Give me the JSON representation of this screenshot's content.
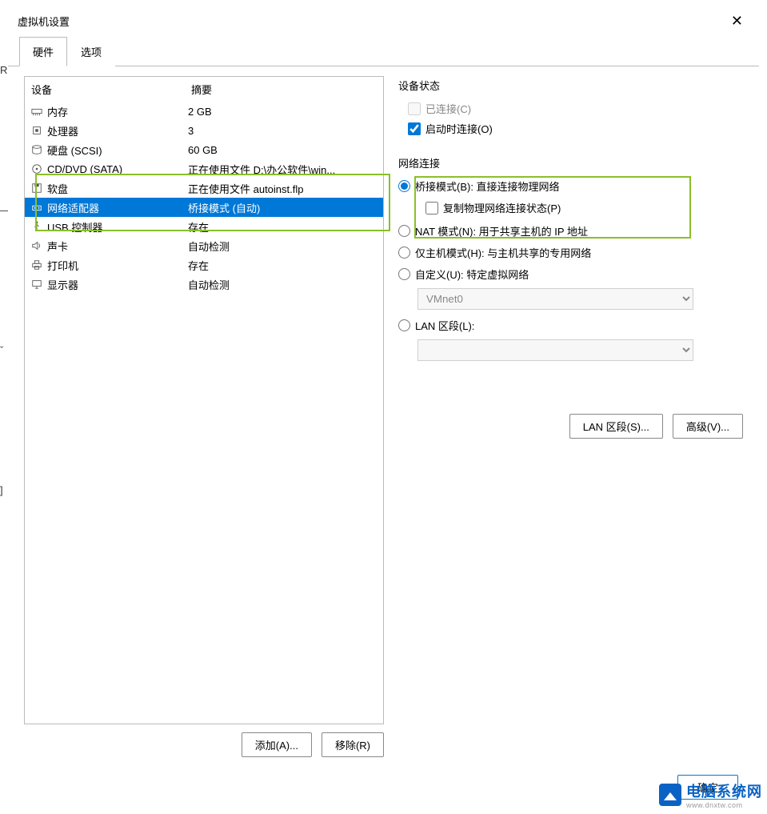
{
  "window": {
    "title": "虚拟机设置"
  },
  "tabs": {
    "hardware": "硬件",
    "options": "选项"
  },
  "device_list": {
    "header_device": "设备",
    "header_summary": "摘要",
    "items": [
      {
        "icon": "memory",
        "name": "内存",
        "summary": "2 GB"
      },
      {
        "icon": "cpu",
        "name": "处理器",
        "summary": "3"
      },
      {
        "icon": "disk",
        "name": "硬盘 (SCSI)",
        "summary": "60 GB"
      },
      {
        "icon": "cd",
        "name": "CD/DVD (SATA)",
        "summary": "正在使用文件 D:\\办公软件\\win..."
      },
      {
        "icon": "floppy",
        "name": "软盘",
        "summary": "正在使用文件 autoinst.flp"
      },
      {
        "icon": "network",
        "name": "网络适配器",
        "summary": "桥接模式 (自动)",
        "selected": true
      },
      {
        "icon": "usb",
        "name": "USB 控制器",
        "summary": "存在"
      },
      {
        "icon": "sound",
        "name": "声卡",
        "summary": "自动检测"
      },
      {
        "icon": "printer",
        "name": "打印机",
        "summary": "存在"
      },
      {
        "icon": "display",
        "name": "显示器",
        "summary": "自动检测"
      }
    ]
  },
  "left_buttons": {
    "add": "添加(A)...",
    "remove": "移除(R)"
  },
  "device_status": {
    "label": "设备状态",
    "connected": "已连接(C)",
    "connect_at_startup": "启动时连接(O)"
  },
  "network": {
    "label": "网络连接",
    "bridged": "桥接模式(B): 直接连接物理网络",
    "replicate": "复制物理网络连接状态(P)",
    "nat": "NAT 模式(N): 用于共享主机的 IP 地址",
    "hostonly": "仅主机模式(H): 与主机共享的专用网络",
    "custom": "自定义(U): 特定虚拟网络",
    "vmnet": "VMnet0",
    "lan": "LAN 区段(L):"
  },
  "right_buttons": {
    "lan": "LAN 区段(S)...",
    "advanced": "高级(V)..."
  },
  "bottom": {
    "ok": "确定"
  },
  "watermark": {
    "main": "电脑系统网",
    "sub": "www.dnxtw.com"
  },
  "edge": {
    "r": "R",
    "dash": "—",
    "caret": "ˇ",
    "bracket": "]"
  }
}
